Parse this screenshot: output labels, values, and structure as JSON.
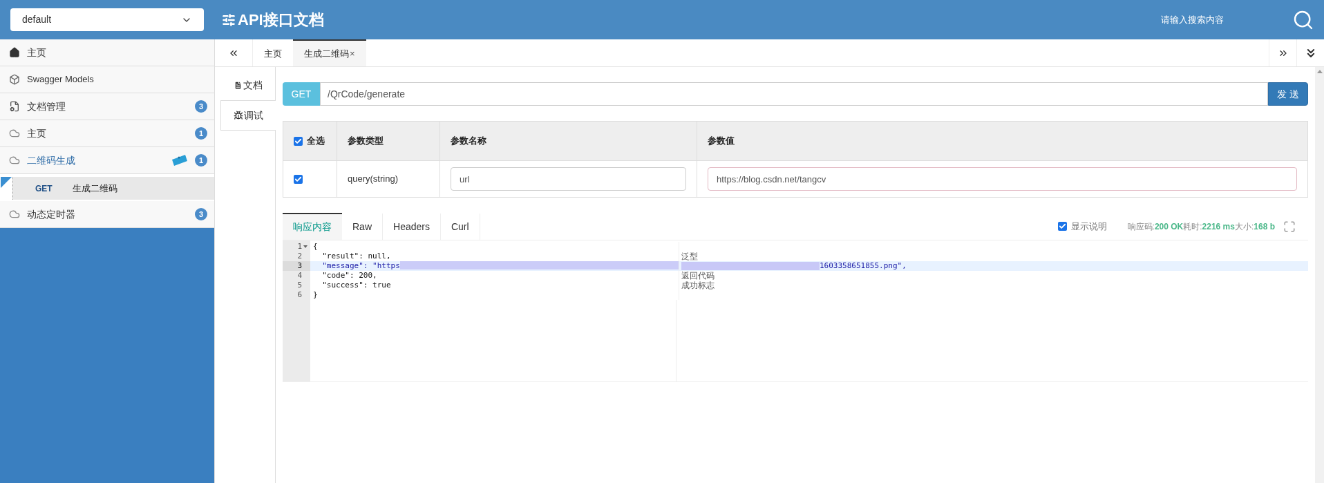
{
  "header": {
    "group_select": {
      "value": "default"
    },
    "title": "API接口文档",
    "search": {
      "placeholder": "请输入搜索内容"
    }
  },
  "sidebar": {
    "items": [
      {
        "kind": "home",
        "label": "主页",
        "selected": false,
        "expanded": false
      },
      {
        "kind": "models",
        "label": "Swagger Models",
        "selected": false,
        "expanded": false
      },
      {
        "kind": "docs",
        "label": "文档管理",
        "badge": "3",
        "selected": false,
        "expanded": false
      },
      {
        "kind": "api",
        "label": "主页",
        "badge": "1",
        "selected": false,
        "expanded": false
      },
      {
        "kind": "api",
        "label": "二维码生成",
        "badge": "1",
        "is_new": true,
        "selected": false,
        "expanded": true,
        "children": [
          {
            "method": "GET",
            "label": "生成二维码",
            "is_new": true,
            "selected": true
          }
        ]
      },
      {
        "kind": "api",
        "label": "动态定时器",
        "badge": "3",
        "selected": false,
        "expanded": false
      }
    ]
  },
  "tabs": [
    {
      "label": "主页",
      "selected": false
    },
    {
      "label": "生成二维码",
      "close": "×",
      "selected": true
    }
  ],
  "side_tabs": [
    {
      "kind": "doc",
      "label": "文档",
      "selected": false
    },
    {
      "kind": "debug",
      "label": "调试",
      "selected": true
    }
  ],
  "request": {
    "method": "GET",
    "path": "/QrCode/generate",
    "send": "发 送"
  },
  "params": {
    "columns": [
      "全选",
      "参数类型",
      "参数名称",
      "参数值"
    ],
    "select_all": true,
    "rows": [
      {
        "checked": true,
        "type": "query(string)",
        "name": "url",
        "value": "https://blog.csdn.net/tangcv"
      }
    ]
  },
  "response": {
    "tabs": [
      {
        "label": "响应内容",
        "selected": true
      },
      {
        "label": "Raw",
        "selected": false
      },
      {
        "label": "Headers",
        "selected": false
      },
      {
        "label": "Curl",
        "selected": false
      }
    ],
    "show_notes": {
      "label": "显示说明",
      "checked": true
    },
    "status": [
      {
        "label": "响应码:",
        "value": "200 OK"
      },
      {
        "label": "耗时:",
        "value": "2216 ms"
      },
      {
        "label": "大小:",
        "value": "168 b"
      }
    ],
    "lines": [
      {
        "number": "1",
        "kind": "plain",
        "text": "{",
        "foldable": true,
        "selected": false
      },
      {
        "number": "2",
        "kind": "plain",
        "text": "  \"result\": null,",
        "comment": "泛型",
        "foldable": false,
        "selected": false
      },
      {
        "number": "3",
        "kind": "masked",
        "text": "  \"message\": \"https",
        "text_after": "1603358651855.png\",",
        "foldable": false,
        "selected": true
      },
      {
        "number": "4",
        "kind": "plain",
        "text": "  \"code\": 200,",
        "comment": "返回代码",
        "foldable": false,
        "selected": false
      },
      {
        "number": "5",
        "kind": "plain",
        "text": "  \"success\": true",
        "comment": "成功标志",
        "foldable": false,
        "selected": false
      },
      {
        "number": "6",
        "kind": "plain",
        "text": "}",
        "foldable": false,
        "selected": false
      }
    ]
  }
}
